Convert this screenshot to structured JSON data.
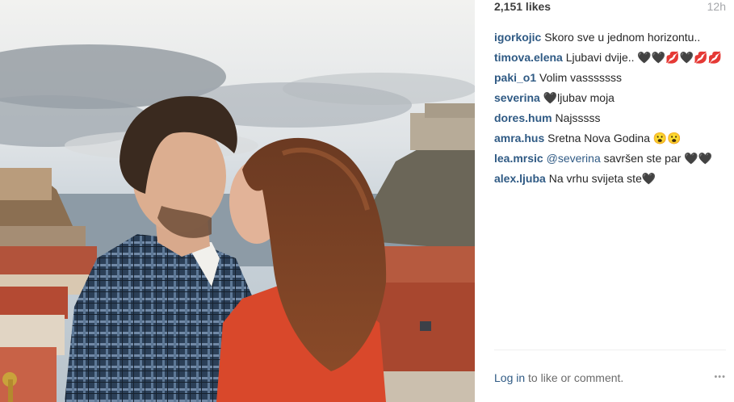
{
  "post": {
    "likes": "2,151 likes",
    "time_ago": "12h",
    "photo_alt": ""
  },
  "comments": [
    {
      "user": "igorkojic",
      "mention": "",
      "text": "Skoro sve u jednom horizontu.."
    },
    {
      "user": "timova.elena",
      "mention": "",
      "text": "Ljubavi dvije.. 🖤🖤💋🖤💋💋"
    },
    {
      "user": "paki_o1",
      "mention": "",
      "text": "Volim vasssssss"
    },
    {
      "user": "severina",
      "mention": "",
      "text": "🖤ljubav moja"
    },
    {
      "user": "dores.hum",
      "mention": "",
      "text": "Najsssss"
    },
    {
      "user": "amra.hus",
      "mention": "",
      "text": "Sretna Nova Godina 😮😮"
    },
    {
      "user": "lea.mrsic",
      "mention": "@severina",
      "text": "savršen ste par 🖤🖤"
    },
    {
      "user": "alex.ljuba",
      "mention": "",
      "text": "Na vrhu svijeta ste🖤"
    }
  ],
  "footer": {
    "login_link": "Log in",
    "login_suffix": "to like or comment.",
    "more_icon": "•••"
  }
}
